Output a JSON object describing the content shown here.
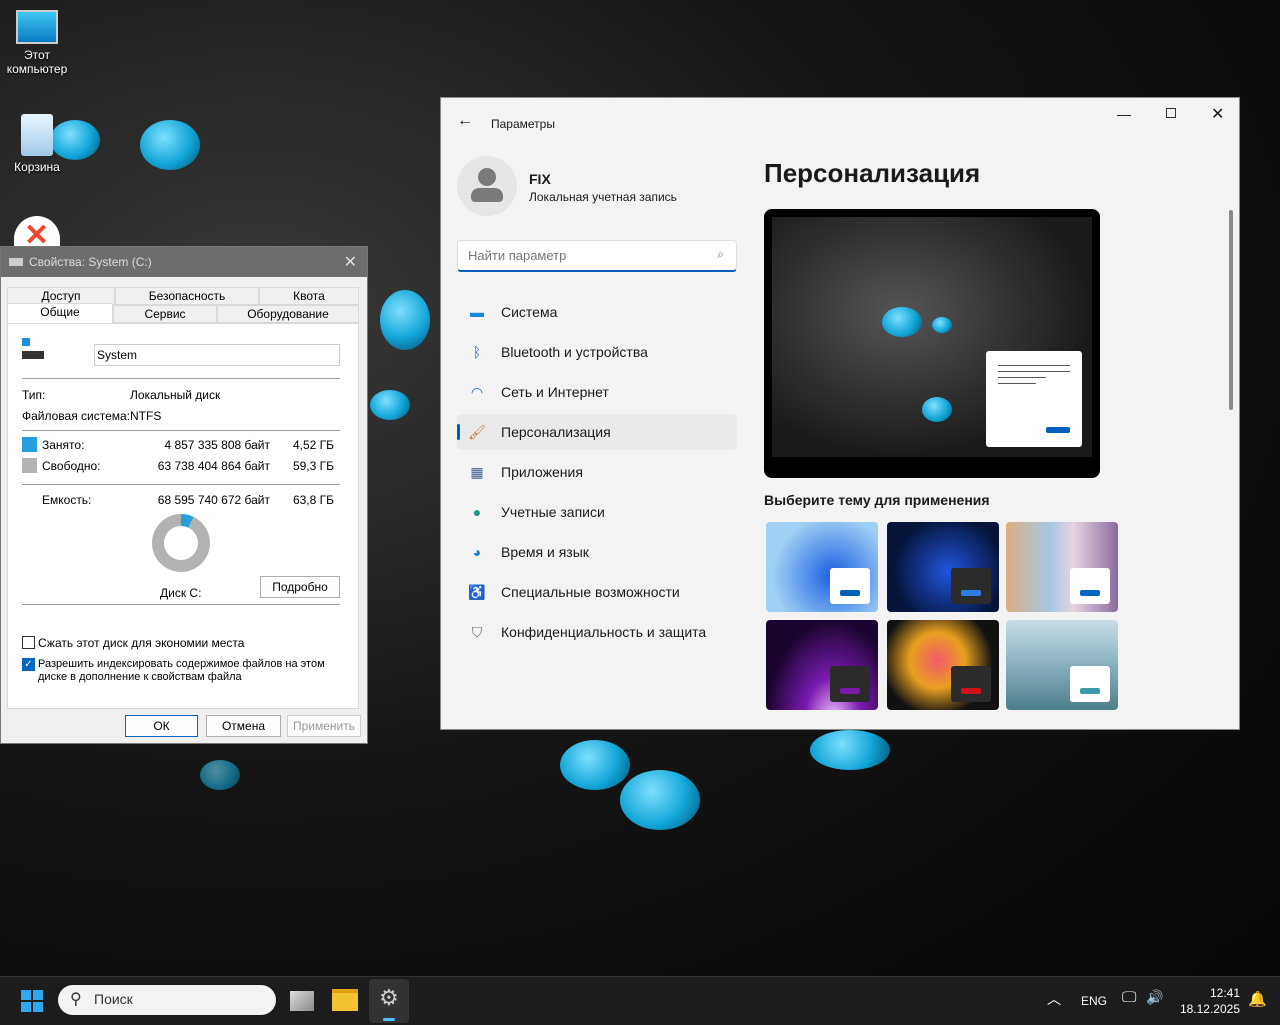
{
  "desktop": {
    "icons": [
      {
        "label": "Этот компьютер"
      },
      {
        "label": "Корзина"
      }
    ]
  },
  "props": {
    "title": "Свойства: System (C:)",
    "tabs_top": [
      "Доступ",
      "Безопасность",
      "Квота"
    ],
    "tabs_bottom": [
      "Общие",
      "Сервис",
      "Оборудование"
    ],
    "name_value": "System",
    "type_label": "Тип:",
    "type_value": "Локальный диск",
    "fs_label": "Файловая система:",
    "fs_value": "NTFS",
    "used_label": "Занято:",
    "used_bytes": "4 857 335 808 байт",
    "used_gb": "4,52 ГБ",
    "free_label": "Свободно:",
    "free_bytes": "63 738 404 864 байт",
    "free_gb": "59,3 ГБ",
    "cap_label": "Емкость:",
    "cap_bytes": "68 595 740 672 байт",
    "cap_gb": "63,8 ГБ",
    "used_fraction": 0.071,
    "disk_label": "Диск C:",
    "details_button": "Подробно",
    "compress_label": "Сжать этот диск для экономии места",
    "compress_checked": false,
    "index_label": "Разрешить индексировать содержимое файлов на этом диске в дополнение к свойствам файла",
    "index_checked": true,
    "ok": "ОК",
    "cancel": "Отмена",
    "apply": "Применить",
    "colors": {
      "used": "#26a0da",
      "free": "#b3b3b3"
    }
  },
  "settings": {
    "app_title": "Параметры",
    "user_name": "FIX",
    "user_type": "Локальная учетная запись",
    "search_placeholder": "Найти параметр",
    "nav": [
      {
        "label": "Система",
        "icon": "monitor-icon"
      },
      {
        "label": "Bluetooth и устройства",
        "icon": "bluetooth-icon"
      },
      {
        "label": "Сеть и Интернет",
        "icon": "wifi-icon"
      },
      {
        "label": "Персонализация",
        "icon": "brush-icon",
        "selected": true
      },
      {
        "label": "Приложения",
        "icon": "apps-icon"
      },
      {
        "label": "Учетные записи",
        "icon": "user-icon"
      },
      {
        "label": "Время и язык",
        "icon": "globe-clock-icon"
      },
      {
        "label": "Специальные возможности",
        "icon": "accessibility-icon"
      },
      {
        "label": "Конфиденциальность и защита",
        "icon": "shield-icon"
      }
    ],
    "page_title": "Персонализация",
    "themes_heading": "Выберите тему для применения",
    "accent": "#005fb8"
  },
  "taskbar": {
    "search_placeholder": "Поиск",
    "lang": "ENG",
    "time": "12:41",
    "date": "18.12.2025"
  }
}
